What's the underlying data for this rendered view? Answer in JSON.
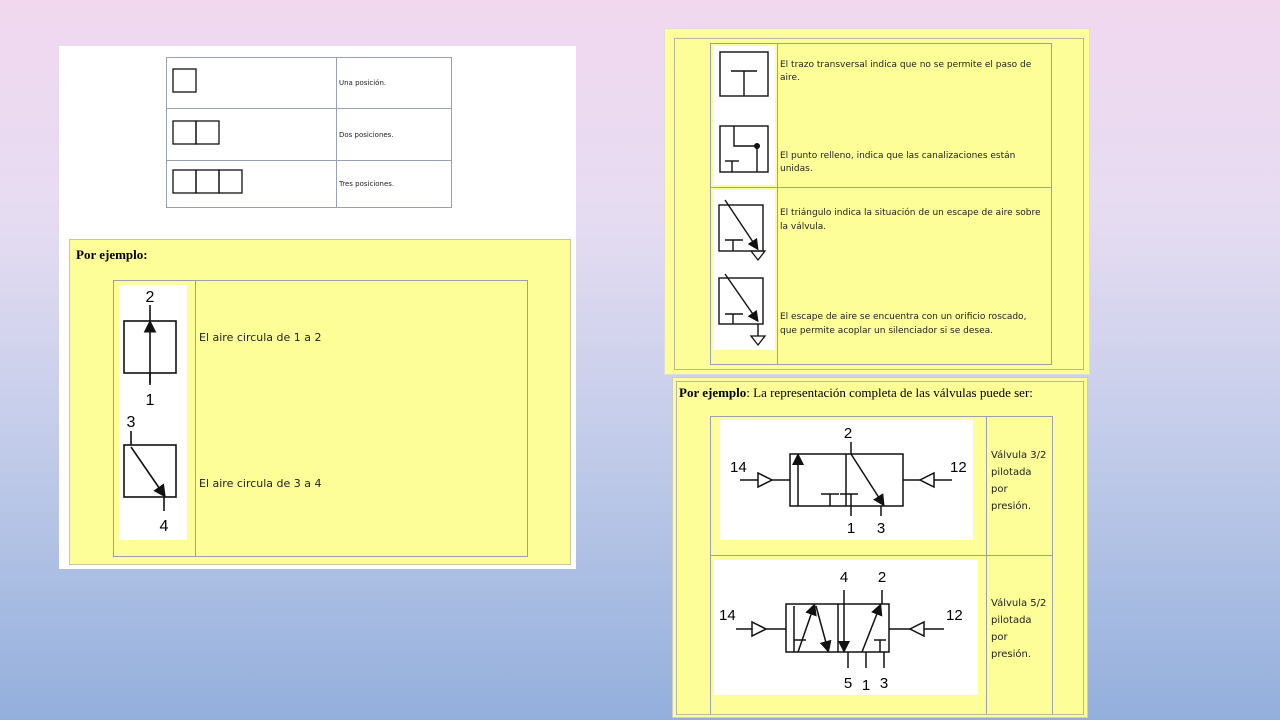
{
  "positions_table": {
    "rows": [
      {
        "label": "Una posición."
      },
      {
        "label": "Dos posiciones."
      },
      {
        "label": "Tres posiciones."
      }
    ]
  },
  "example_left": {
    "heading": "Por ejemplo:",
    "rows": [
      {
        "text": "El aire circula de 1 a 2",
        "port_top": "2",
        "port_bottom": "1"
      },
      {
        "text": "El aire circula de 3 a 4",
        "port_top": "3",
        "port_bottom": "4"
      }
    ]
  },
  "symbols_table": {
    "rows": [
      {
        "text": "El trazo transversal indica que no se permite el paso de aire."
      },
      {
        "text": "El punto relleno, indica que las canalizaciones están unidas."
      },
      {
        "text": "El triángulo indica la situación de un escape de aire sobre la válvula."
      },
      {
        "text": "El escape de aire se encuentra con un orificio roscado, que permite acoplar un silenciador si se desea."
      }
    ]
  },
  "example_right": {
    "heading_bold": "Por ejemplo",
    "heading_rest": ": La representación completa de las válvulas puede ser:",
    "valves": [
      {
        "label": "Válvula 3/2 pilotada por presión.",
        "ports": {
          "left": "14",
          "right": "12",
          "top": "2",
          "bottom_a": "1",
          "bottom_b": "3"
        }
      },
      {
        "label": "Válvula 5/2 pilotada por presión.",
        "ports": {
          "left": "14",
          "right": "12",
          "top_a": "4",
          "top_b": "2",
          "bottom_a": "5",
          "bottom_b": "1",
          "bottom_c": "3"
        }
      }
    ]
  }
}
